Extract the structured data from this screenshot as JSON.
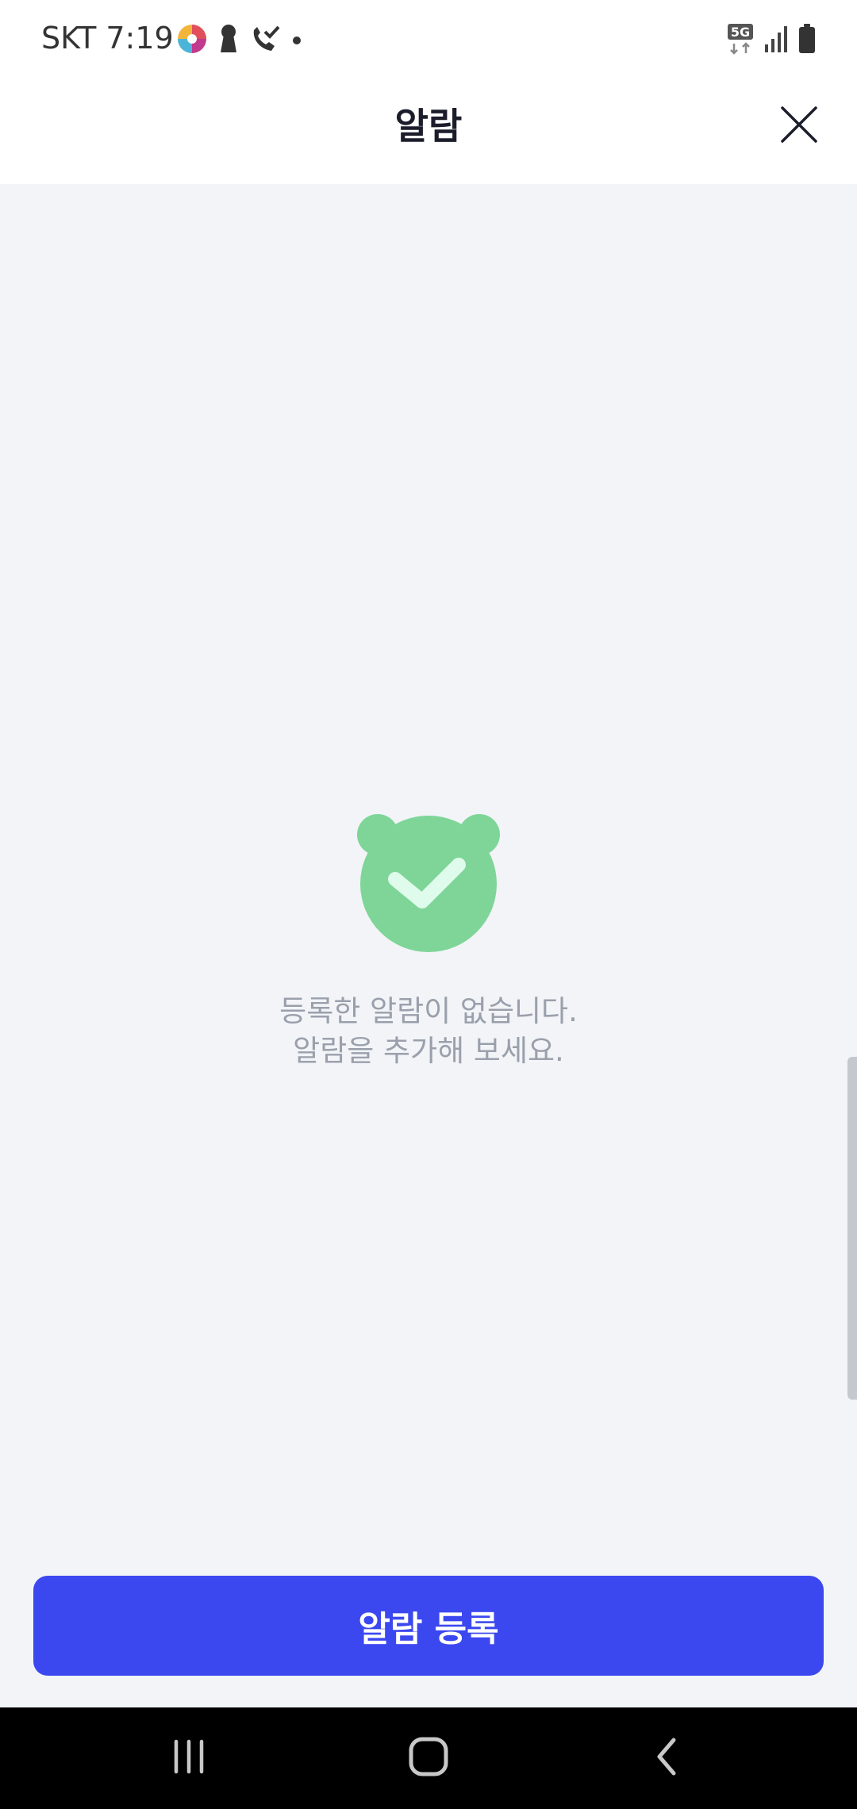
{
  "status_bar": {
    "carrier_time": "SKT 7:19",
    "network_badge": "5G",
    "icons": [
      "pinwheel-app-icon",
      "keyhole-icon",
      "missed-call-icon",
      "notification-dot-icon",
      "5g-icon",
      "signal-icon",
      "battery-icon"
    ]
  },
  "header": {
    "title": "알람",
    "close_icon": "close-icon"
  },
  "empty_state": {
    "icon": "bear-check-icon",
    "line1": "등록한 알람이 없습니다.",
    "line2": "알람을 추가해 보세요."
  },
  "actions": {
    "register_label": "알람 등록"
  },
  "nav": {
    "icons": [
      "recents-icon",
      "home-icon",
      "back-icon"
    ]
  },
  "colors": {
    "accent": "#3b48ef",
    "illustration_green": "#7ed597",
    "check_mint": "#dffbec",
    "background": "#f2f4f8"
  }
}
